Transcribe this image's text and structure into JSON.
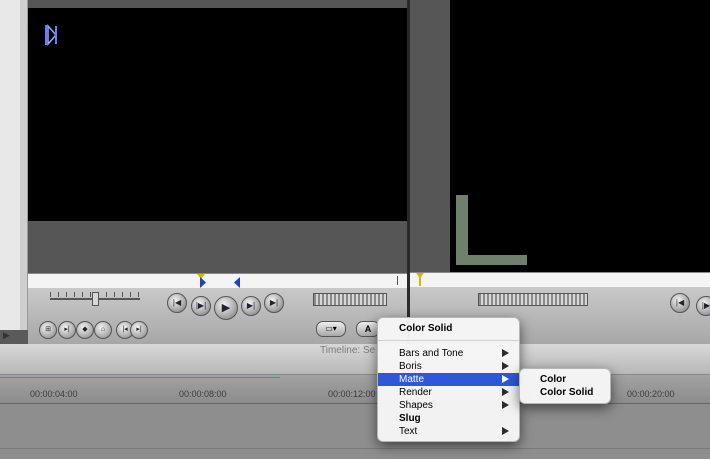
{
  "timeline": {
    "title": "Timeline: Se",
    "timecodes": [
      "00:00:04:00",
      "00:00:08:00",
      "00:00:12:00",
      "00:00:20:00"
    ]
  },
  "viewer": {
    "generator_buttons": {
      "video": "▭▾",
      "text": "A"
    }
  },
  "context_menu": {
    "header": "Color Solid",
    "items": [
      {
        "label": "Bars and Tone",
        "submenu": true,
        "bold": false,
        "highlighted": false
      },
      {
        "label": "Boris",
        "submenu": true,
        "bold": false,
        "highlighted": false
      },
      {
        "label": "Matte",
        "submenu": true,
        "bold": false,
        "highlighted": true
      },
      {
        "label": "Render",
        "submenu": true,
        "bold": false,
        "highlighted": false
      },
      {
        "label": "Shapes",
        "submenu": true,
        "bold": false,
        "highlighted": false
      },
      {
        "label": "Slug",
        "submenu": false,
        "bold": true,
        "highlighted": false
      },
      {
        "label": "Text",
        "submenu": true,
        "bold": false,
        "highlighted": false
      }
    ]
  },
  "submenu": {
    "items": [
      "Color",
      "Color Solid"
    ]
  },
  "colors": {
    "highlight": "#2f58d8",
    "canvas_shape": "#6f806c"
  }
}
